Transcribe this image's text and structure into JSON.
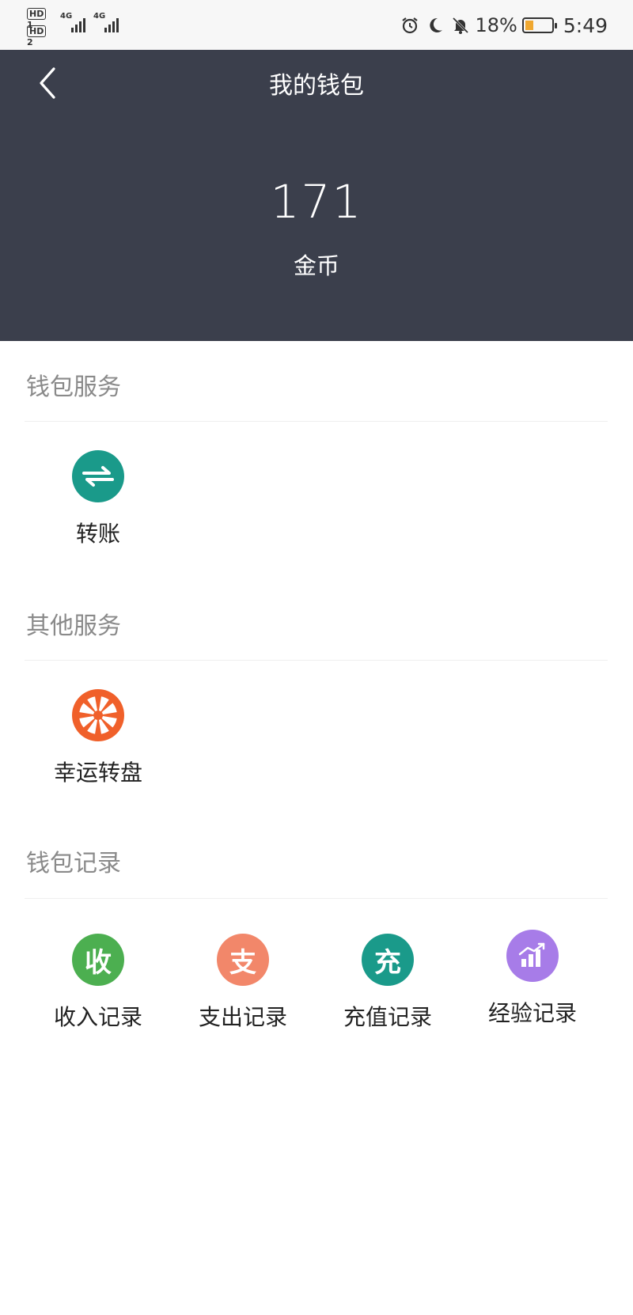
{
  "status_bar": {
    "hd1": "HD",
    "sim1": "1",
    "hd2": "HD",
    "sim2": "2",
    "net1": "4G",
    "net2": "4G",
    "battery": "18%",
    "time": "5:49",
    "icons": [
      "alarm-icon",
      "moon-icon",
      "bell-off-icon",
      "battery-icon"
    ]
  },
  "header": {
    "title": "我的钱包",
    "balance": "171",
    "unit": "金币",
    "bg_color": "#3b3f4c"
  },
  "sections": {
    "wallet_service": {
      "title": "钱包服务",
      "items": [
        {
          "label": "转账",
          "icon": "transfer-icon",
          "color": "#1a9a8a"
        }
      ]
    },
    "other_service": {
      "title": "其他服务",
      "items": [
        {
          "label": "幸运转盘",
          "icon": "wheel-icon",
          "color": "#f0602a"
        }
      ]
    },
    "wallet_records": {
      "title": "钱包记录",
      "items": [
        {
          "label": "收入记录",
          "glyph": "收",
          "color": "#4caf50"
        },
        {
          "label": "支出记录",
          "glyph": "支",
          "color": "#f2876a"
        },
        {
          "label": "充值记录",
          "glyph": "充",
          "color": "#1a9a8a"
        },
        {
          "label": "经验记录",
          "icon": "bar-chart-icon",
          "color": "#a77ce8"
        }
      ]
    }
  }
}
